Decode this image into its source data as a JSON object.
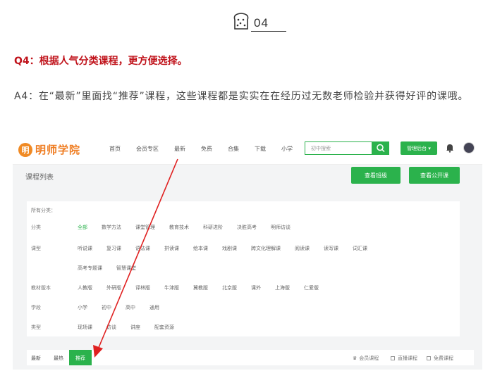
{
  "section": {
    "number": "04"
  },
  "question": "Q4：根据人气分类课程，更方便选择。",
  "answer": "A4：在“最新”里面找“推荐”课程，这些课程都是实实在在经历过无数老师检验并获得好评的课哦。",
  "site": {
    "logo_mark": "明",
    "logo_text": "明师学院",
    "nav": [
      "首页",
      "会员专区",
      "最新",
      "免费",
      "合集",
      "下载",
      "小学"
    ],
    "search_placeholder": "初中搜索",
    "admin_label": "管理后台",
    "page_title": "课程列表",
    "btn_class": "查看班级",
    "btn_public": "查看公开课"
  },
  "filters": {
    "all_label": "所有分类：",
    "rows": [
      {
        "label": "分类",
        "items": [
          "全部",
          "数学方法",
          "课堂管理",
          "教育技术",
          "科研进阶",
          "决胜高考",
          "明师访谈"
        ]
      },
      {
        "label": "课型",
        "items": [
          "听说课",
          "复习课",
          "语法课",
          "拼读课",
          "绘本课",
          "戏剧课",
          "跨文化理解课",
          "阅读课",
          "读写课",
          "词汇课"
        ]
      },
      {
        "label": "",
        "items": [
          "高考专题课",
          "智慧课堂"
        ]
      },
      {
        "label": "教材版本",
        "items": [
          "人教版",
          "外研版",
          "译林版",
          "牛津版",
          "冀教版",
          "北京版",
          "课外",
          "上海版",
          "仁爱版"
        ]
      },
      {
        "label": "学段",
        "items": [
          "小学",
          "初中",
          "高中",
          "通用"
        ]
      },
      {
        "label": "类型",
        "items": [
          "现场课",
          "访谈",
          "讲座",
          "配套资源"
        ]
      }
    ]
  },
  "tabs": {
    "newest": "最新",
    "hottest": "最热",
    "recommended": "推荐"
  },
  "options": {
    "member": "会员课程",
    "live": "直播课程",
    "free": "免费课程"
  },
  "colors": {
    "accent": "#2bb24c",
    "question": "#c0131b",
    "arrow": "#e02020",
    "brand": "#ef7d22"
  }
}
